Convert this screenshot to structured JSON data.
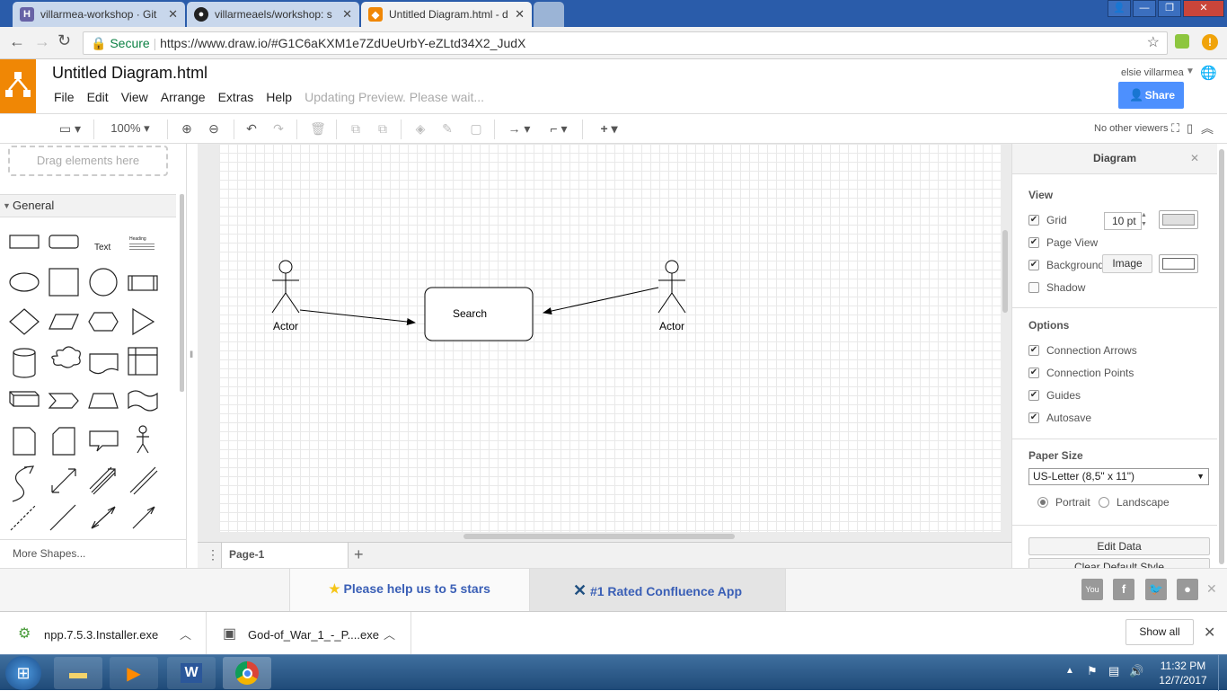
{
  "browser": {
    "tabs": [
      {
        "title": "villarmea-workshop · Git",
        "icon": "heroku-icon",
        "color": "#6762a6"
      },
      {
        "title": "villarmeaels/workshop: s",
        "icon": "github-icon",
        "color": "#222222"
      },
      {
        "title": "Untitled Diagram.html - d",
        "icon": "drawio-icon",
        "color": "#f08705"
      }
    ],
    "secure_label": "Secure",
    "url": "https://www.draw.io/#G1C6aKXM1e7ZdUeUrbY-eZLtd34X2_JudX"
  },
  "app": {
    "title": "Untitled Diagram.html",
    "menu": [
      "File",
      "Edit",
      "View",
      "Arrange",
      "Extras",
      "Help"
    ],
    "status": "Updating Preview. Please wait...",
    "user": "elsie villarmea",
    "share_label": "Share",
    "viewers": "No other viewers",
    "accent": "#f08705",
    "share_color": "#4d90fe"
  },
  "toolbar": {
    "zoom": "100%"
  },
  "left_panel": {
    "drag_hint": "Drag elements here",
    "section": "General",
    "text_shape": "Text",
    "heading_shape": "Heading",
    "more_shapes": "More Shapes..."
  },
  "diagram": {
    "actor_left_label": "Actor",
    "actor_right_label": "Actor",
    "box_label": "Search"
  },
  "pages": {
    "current": "Page-1"
  },
  "format_panel": {
    "title": "Diagram",
    "view_title": "View",
    "grid_label": "Grid",
    "grid_size": "10 pt",
    "page_view_label": "Page View",
    "background_label": "Background",
    "image_button": "Image",
    "shadow_label": "Shadow",
    "options_title": "Options",
    "options": [
      "Connection Arrows",
      "Connection Points",
      "Guides",
      "Autosave"
    ],
    "paper_title": "Paper Size",
    "paper_size": "US-Letter (8,5\" x 11\")",
    "portrait": "Portrait",
    "landscape": "Landscape",
    "edit_data": "Edit Data",
    "clear_style": "Clear Default Style"
  },
  "banner": {
    "stars": "Please help us to 5 stars",
    "confluence": "#1 Rated Confluence App"
  },
  "downloads": {
    "items": [
      "npp.7.5.3.Installer.exe",
      "God-of_War_1_-_P....exe"
    ],
    "show_all": "Show all"
  },
  "taskbar": {
    "time": "11:32 PM",
    "date": "12/7/2017"
  }
}
